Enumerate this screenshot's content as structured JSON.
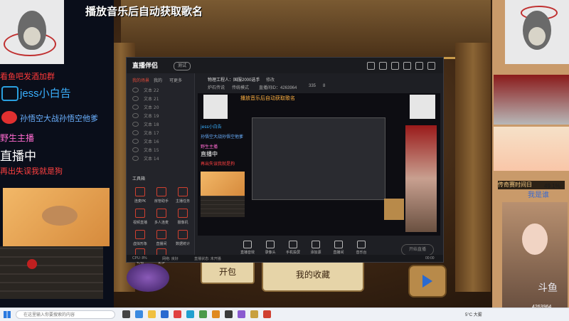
{
  "overlay": {
    "title_banner": "播放音乐后自动获取歌名",
    "fan_group": "看鱼吧发酒加群",
    "bilibili_label": "jess小白告",
    "weibo_label": "孙悟空大战孙悟空他爹",
    "wild_anchor": "野生主播",
    "live_label": "直播中",
    "lose_label": "再出失误我就是狗"
  },
  "game": {
    "open_pack": "开包",
    "my_collection": "我的收藏"
  },
  "right_panel": {
    "stat_text": "传奇赛时间日",
    "percent": "49.1%",
    "name": "我是谁",
    "platform": "斗鱼",
    "room_id": "4263964"
  },
  "app": {
    "logo": "直播伴侣",
    "version": "测试",
    "sidebar_tabs": [
      "我的场景",
      "我的",
      "可更多"
    ],
    "scenes": [
      "文本 22",
      "文本 21",
      "文本 20",
      "文本 19",
      "文本 18",
      "文本 17",
      "文本 16",
      "文本 15",
      "文本 14"
    ],
    "tools_title": "工具箱",
    "tools": [
      "连麦PK",
      "房管助手",
      "主播任务",
      "视频直播",
      "多人连麦",
      "摄像机",
      "虚拟形象",
      "直播间",
      "数据统计",
      "礼物",
      "更多"
    ],
    "info": {
      "room_title": "物理工程人：国服2000选手",
      "edit": "修改",
      "category": "炉石传说",
      "tag": "传统模式",
      "room_id_label": "直播间ID：4263964",
      "viewers": "335",
      "fans": "8"
    },
    "preview": {
      "title": "播放音乐后自动获取歌名",
      "bili": "jess小白告",
      "weibo": "孙悟空大战孙悟空他爹",
      "wild": "野生主播",
      "live": "直播中",
      "lose": "再出失误我就是狗"
    },
    "controls": [
      "直播音效",
      "录像头",
      "手机投屏",
      "添加源",
      "直播间",
      "音乐台"
    ],
    "start_button": "开始直播",
    "status": {
      "cpu": "CPU: 8%",
      "network": "网络: 良好",
      "live": "直播状态: 未开播",
      "time": "00:00"
    }
  },
  "taskbar": {
    "search_placeholder": "在这里输入你要搜索的内容",
    "weather": "5°C 大雾"
  },
  "colors": {
    "accent_red": "#d04030",
    "banner_white": "#ffffff",
    "bili_blue": "#3ab0ff"
  }
}
